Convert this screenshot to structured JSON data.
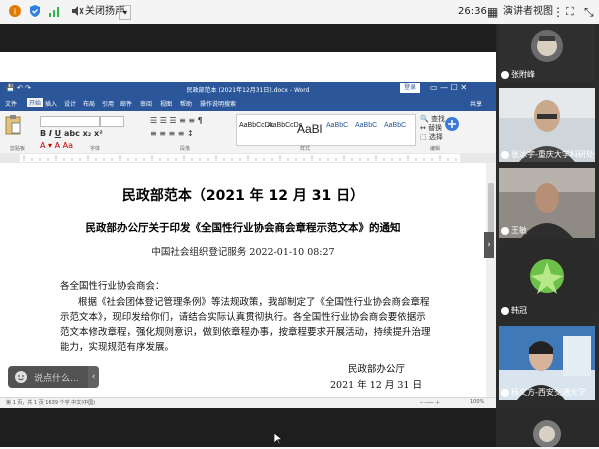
{
  "topbar": {
    "speaker_label": "关闭扬声",
    "time": "26:36",
    "view_label": "演讲者视图"
  },
  "word": {
    "title": "民政部范本 (2021年12月31日).docx - Word",
    "login": "登录",
    "tabs": [
      "文件",
      "开始",
      "插入",
      "设计",
      "布局",
      "引用",
      "邮件",
      "审阅",
      "视图",
      "帮助",
      "操作说明搜索"
    ],
    "share": "共享",
    "styles": [
      "AaBbCcDc",
      "AaBbCcDc",
      "AaBl",
      "AaBbC",
      "AaBbC",
      "AaBbC"
    ],
    "group_labels": [
      "剪贴板",
      "字体",
      "段落",
      "样式",
      "编辑"
    ],
    "status": "第 1 页，共 1 页    1639 个字    中文(中国)",
    "zoom": "100%"
  },
  "doc": {
    "title": "民政部范本（2021 年 12 月 31 日）",
    "subtitle": "民政部办公厅关于印发《全国性行业协会商会章程示范文本》的通知",
    "source": "中国社会组织登记服务  2022-01-10 08:27",
    "salutation": "各全国性行业协会商会：",
    "para1": "根据《社会团体登记管理条例》等法规政策，我部制定了《全国性行业协会商会章程",
    "para2": "示范文本》，现印发给你们，请结合实际认真贯彻执行。各全国性行业协会商会要依据示",
    "para3": "范文本修改章程，强化规则意识，做到依章程办事，按章程要求开展活动，持续提升治理",
    "para4": "能力，实现规范有序发展。",
    "signature": "民政部办公厅",
    "date": "2021 年 12 月 31 日"
  },
  "chat": {
    "placeholder": "说点什么..."
  },
  "participants": [
    {
      "name": "张附峰"
    },
    {
      "name": "张冰宇-重庆大学科研处学院"
    },
    {
      "name": "王敏"
    },
    {
      "name": "韩冠"
    },
    {
      "name": "杨文方-西安交通大学"
    }
  ],
  "colors": {
    "word_blue": "#2b579a",
    "meeting_dark": "#1e1e1e"
  }
}
